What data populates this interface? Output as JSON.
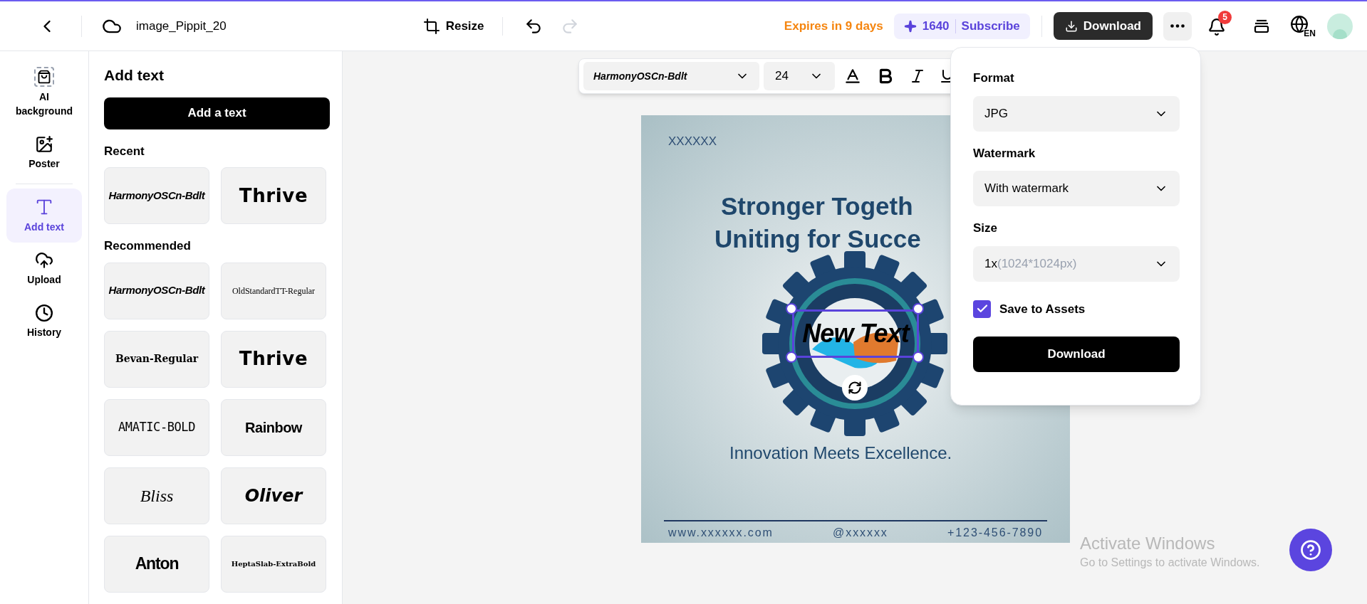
{
  "topbar": {
    "file_name": "image_Pippit_20",
    "resize": "Resize",
    "redo_disabled": true,
    "expiry": "Expires in 9 days",
    "credits": "1640",
    "subscribe": "Subscribe",
    "download": "Download",
    "notifications": "5",
    "language": "EN"
  },
  "rail": [
    {
      "label": "AI background",
      "kind": "ai",
      "selected": false
    },
    {
      "label": "Poster",
      "kind": "poster",
      "selected": false
    },
    {
      "label": "Add text",
      "kind": "text",
      "selected": true
    },
    {
      "label": "Upload",
      "kind": "upload",
      "selected": false
    },
    {
      "label": "History",
      "kind": "history",
      "selected": false
    }
  ],
  "panel": {
    "title": "Add text",
    "add_button": "Add a text",
    "sections": [
      {
        "title": "Recent",
        "fonts": [
          {
            "label": "HarmonyOSCn-Bdlt",
            "kind": "condensed"
          },
          {
            "label": "Thrive",
            "kind": "brush"
          }
        ]
      },
      {
        "title": "Recommended",
        "fonts": [
          {
            "label": "HarmonyOSCn-Bdlt",
            "kind": "condensed"
          },
          {
            "label": "OldStandardTT-Regular",
            "kind": "serif-light"
          },
          {
            "label": "Bevan-Regular",
            "kind": "slab"
          },
          {
            "label": "Thrive",
            "kind": "brush"
          },
          {
            "label": "AMATIC-BOLD",
            "kind": "hand"
          },
          {
            "label": "Rainbow",
            "kind": "display"
          },
          {
            "label": "Bliss",
            "kind": "script"
          },
          {
            "label": "Oliver",
            "kind": "heavy-italic"
          },
          {
            "label": "Anton",
            "kind": "impact"
          },
          {
            "label": "HeptaSlab-ExtraBold",
            "kind": "slab-small"
          }
        ]
      }
    ]
  },
  "toolbar": {
    "font": "HarmonyOSCn-Bdlt",
    "size": "24"
  },
  "poster": {
    "tag": "XXXXXX",
    "headline": [
      "Stronger Togeth",
      "Uniting for Succe"
    ],
    "selected_text": "New Text",
    "tagline": "Innovation Meets Excellence.",
    "footer": [
      "www.xxxxxx.com",
      "@xxxxxx",
      "+123-456-7890"
    ]
  },
  "download_menu": {
    "fields": [
      {
        "label": "Format",
        "value": "JPG"
      },
      {
        "label": "Watermark",
        "value": "With watermark"
      },
      {
        "label": "Size",
        "value": "1x",
        "detail": "(1024*1024px)"
      }
    ],
    "save_to_assets": {
      "label": "Save to Assets",
      "checked": true
    },
    "button": "Download"
  },
  "os_notice": {
    "title": "Activate Windows",
    "text": "Go to Settings to activate Windows."
  }
}
